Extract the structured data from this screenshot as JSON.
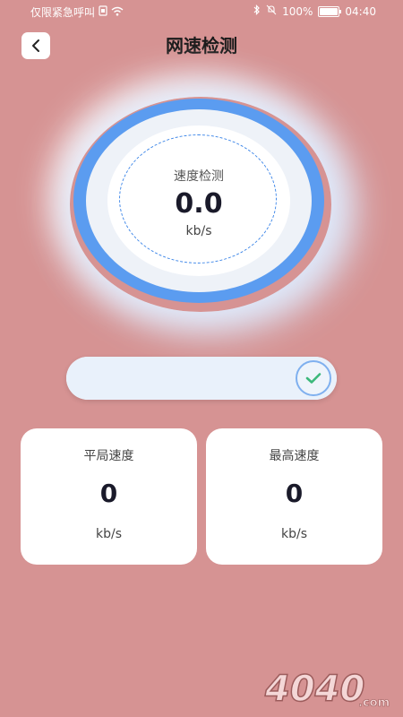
{
  "status_bar": {
    "carrier": "仅限紧急呼叫",
    "battery": "100%",
    "time": "04:40",
    "battery_level": 1.0
  },
  "header": {
    "title": "网速检测",
    "back_icon": "chevron-left-icon"
  },
  "gauge": {
    "label": "速度检测",
    "value": "0.0",
    "unit": "kb/s"
  },
  "progress": {
    "value_percent": 100,
    "status_icon": "check-icon"
  },
  "cards": {
    "average": {
      "title": "平局速度",
      "value": "0",
      "unit": "kb/s"
    },
    "max": {
      "title": "最高速度",
      "value": "0",
      "unit": "kb/s"
    }
  },
  "watermark": {
    "text": "4040",
    "suffix": ".com"
  },
  "colors": {
    "background": "#d69393",
    "gauge_ring": "#5b9cf0",
    "check": "#3bb87a"
  }
}
